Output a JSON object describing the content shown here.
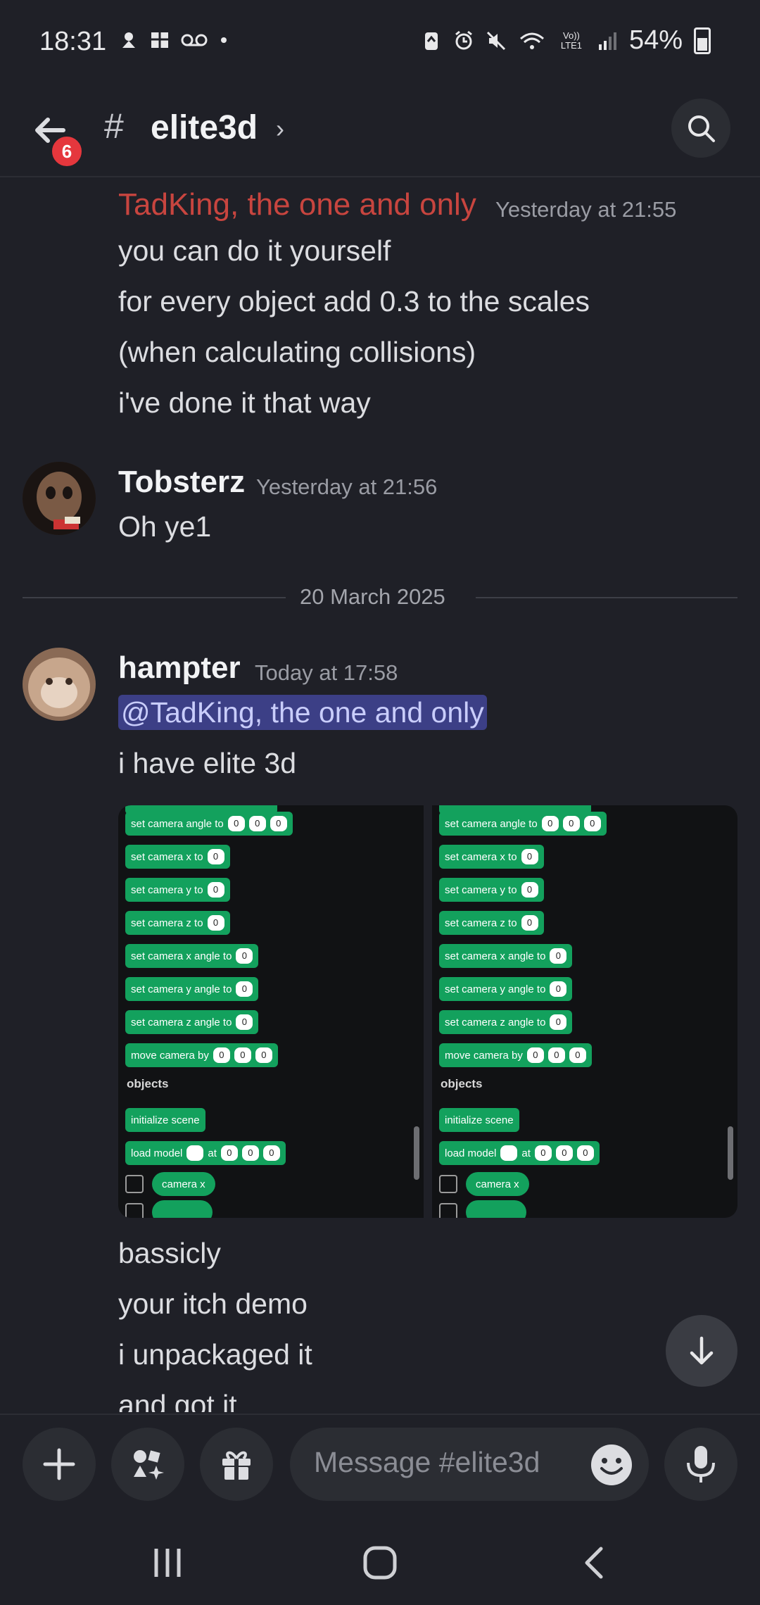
{
  "status_bar": {
    "time": "18:31",
    "battery": "54%",
    "left_icons": [
      "notification-icon",
      "gallery-icon",
      "voicemail-icon",
      "dot-icon"
    ],
    "right_icons": [
      "battery-saver-icon",
      "alarm-icon",
      "mute-icon",
      "wifi-icon",
      "volte-icon",
      "signal-icon"
    ],
    "volte_label": "Vo)) LTE1"
  },
  "header": {
    "channel_name": "elite3d",
    "badge_count": "6"
  },
  "messages": [
    {
      "username": "TadKing, the one and only",
      "timestamp": "Yesterday at 21:55",
      "lines": [
        "you can do it yourself",
        "for every object add 0.3 to the scales",
        "(when calculating collisions)",
        "i've done it that way"
      ]
    },
    {
      "username": "Tobsterz",
      "timestamp": "Yesterday at 21:56",
      "lines": [
        "Oh ye1"
      ]
    },
    {
      "username": "hampter",
      "timestamp": "Today at 17:58",
      "mention": "@TadKing, the one and only",
      "lines": [
        "i have elite 3d"
      ],
      "after_lines": [
        "bassicly",
        "your itch demo",
        "i unpackaged it",
        "and got it"
      ]
    }
  ],
  "date_divider": "20 March 2025",
  "attachment": {
    "blocks": [
      {
        "label": "set camera angle to",
        "slots": [
          "0",
          "0",
          "0"
        ]
      },
      {
        "label": "set camera x to",
        "slots": [
          "0"
        ]
      },
      {
        "label": "set camera y to",
        "slots": [
          "0"
        ]
      },
      {
        "label": "set camera z to",
        "slots": [
          "0"
        ]
      },
      {
        "label": "set camera x angle to",
        "slots": [
          "0"
        ]
      },
      {
        "label": "set camera y angle to",
        "slots": [
          "0"
        ]
      },
      {
        "label": "set camera z angle to",
        "slots": [
          "0"
        ]
      },
      {
        "label": "move camera by",
        "slots": [
          "0",
          "0",
          "0"
        ]
      }
    ],
    "category": "objects",
    "init_block": "initialize scene",
    "load_block": {
      "label": "load model",
      "at": "at",
      "slots": [
        "0",
        "0",
        "0"
      ]
    },
    "reporter": "camera x"
  },
  "composer": {
    "placeholder": "Message #elite3d"
  },
  "colors": {
    "background": "#1f2027",
    "accent_red": "#c8453f",
    "mention_bg": "#3c3f86",
    "block_green": "#13a15d"
  }
}
